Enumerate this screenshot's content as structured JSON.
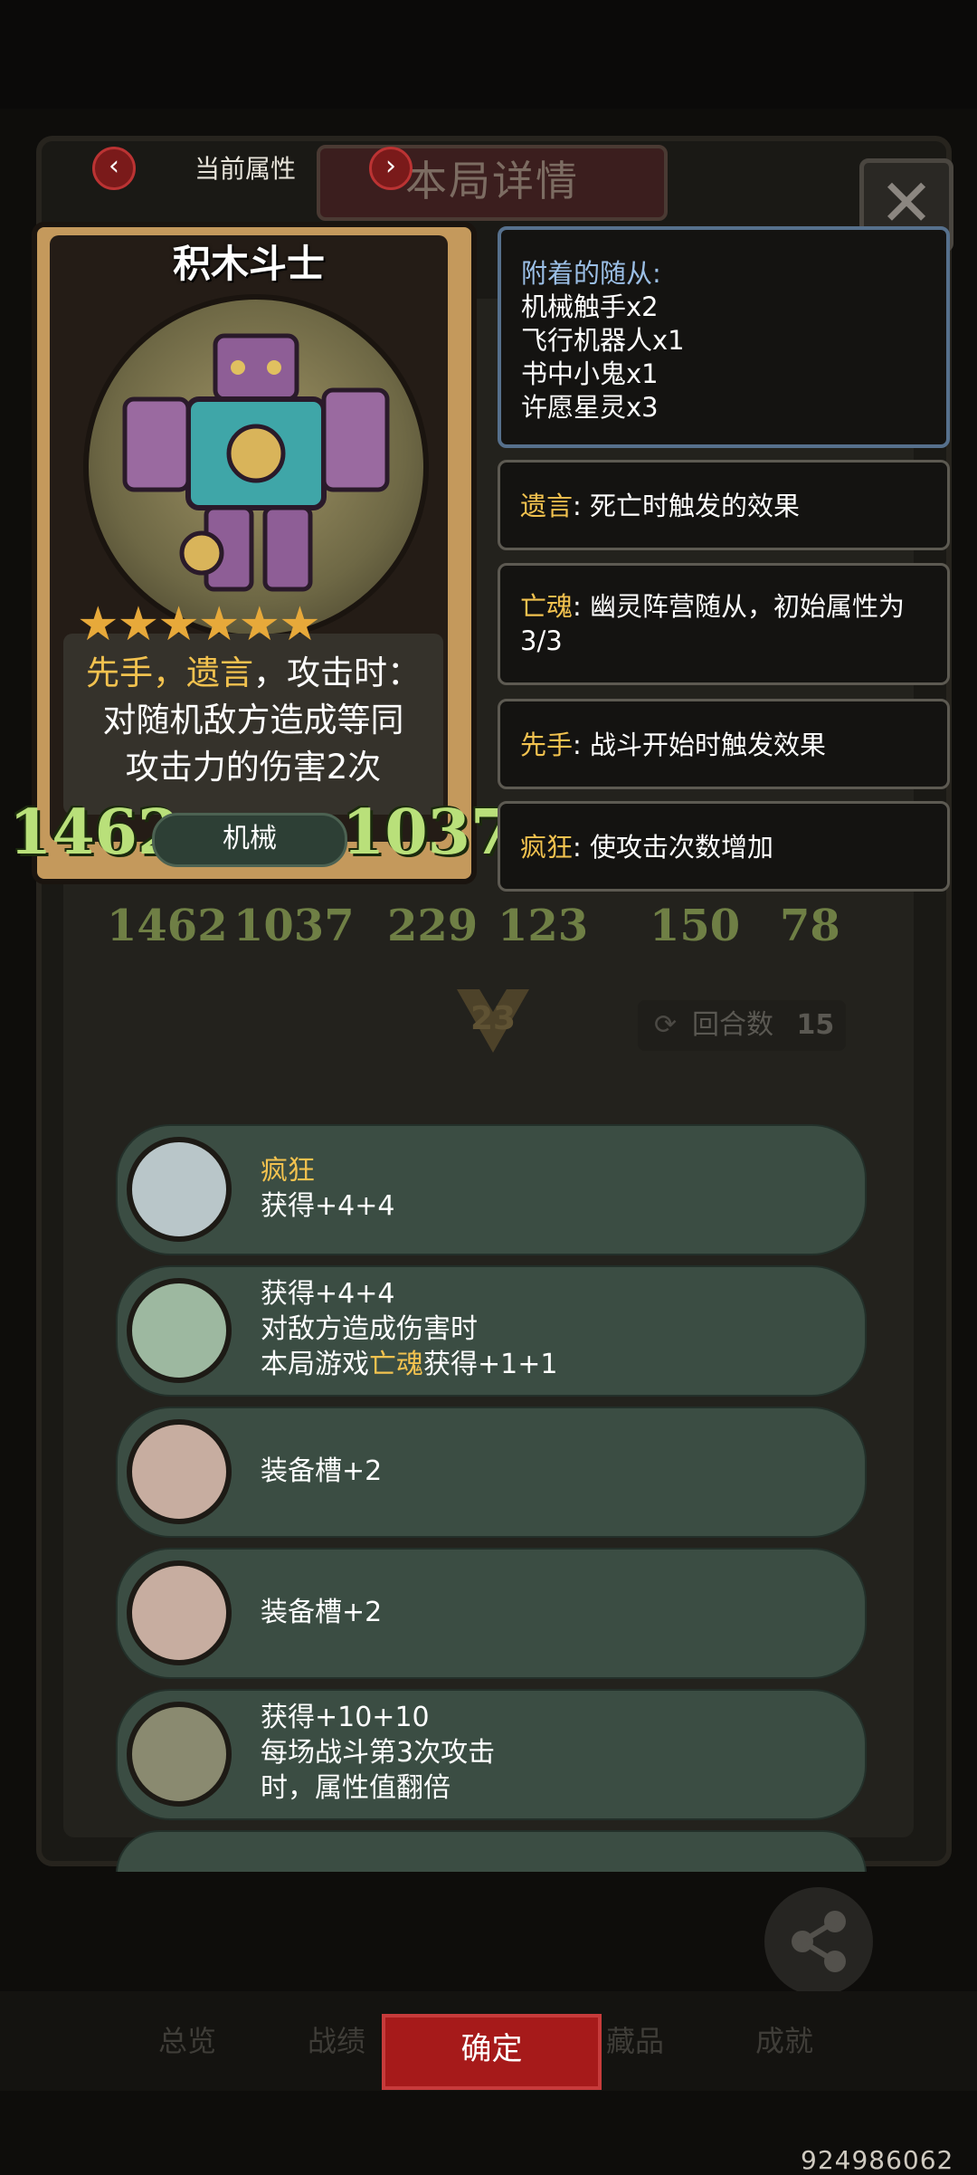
{
  "header": {
    "prev_arrow": "‹",
    "next_arrow": "›",
    "current_attr_label": "当前属性",
    "tab_title": "本局详情",
    "close": "✕"
  },
  "card": {
    "name": "积木斗士",
    "stars": "★★★★★★",
    "star_count": 6,
    "desc_line1_gold": "先手，遗言",
    "desc_line1_rest": "，攻击时：",
    "desc_line2": "对随机敌方造成等同",
    "desc_line3": "攻击力的伤害2次",
    "attack": "1462",
    "health": "1037",
    "type": "机械"
  },
  "info_boxes": {
    "attached_title": "附着的随从:",
    "attached": [
      "机械触手x2",
      "飞行机器人x1",
      "书中小鬼x1",
      "许愿星灵x3"
    ],
    "keywords": [
      {
        "key": "遗言",
        "text": ": 死亡时触发的效果"
      },
      {
        "key": "亡魂",
        "text": ": 幽灵阵营随从，初始属性为"
      },
      {
        "key": "先手",
        "text": ": 战斗开始时触发效果"
      },
      {
        "key": "疯狂",
        "text": ": 使攻击次数增加"
      }
    ],
    "keyword2_line2": "3/3"
  },
  "board": {
    "stats": [
      "1462",
      "1037",
      "229",
      "123",
      "150",
      "78"
    ],
    "chevron_num": "23",
    "round_label": "回合数",
    "round_value": "15"
  },
  "events": [
    {
      "title": "疯狂",
      "line1": "获得+4+4",
      "icon": "rune-stone-icon"
    },
    {
      "line1": "获得+4+4",
      "line2": "对敌方造成伤害时",
      "line3_pre": "本局游戏",
      "line3_gold": "亡魂",
      "line3_post": "获得+1+1",
      "icon": "green-blades-icon"
    },
    {
      "line1": "装备槽+2",
      "icon": "pig-armor-icon"
    },
    {
      "line1": "装备槽+2",
      "icon": "pig-armor-icon"
    },
    {
      "line1": "获得+10+10",
      "line2": "每场战斗第3次攻击",
      "line3": "时，属性值翻倍",
      "icon": "shadow-figure-icon"
    }
  ],
  "bottom": {
    "tabs": [
      "总览",
      "战绩",
      "藏品",
      "成就"
    ],
    "confirm": "确定",
    "share": "分享",
    "id": "924986062"
  },
  "colors": {
    "accent_red": "#a61a1a",
    "gold": "#f2c24f",
    "stat_green": "#b9e07a",
    "panel_teal": "#3b4d43"
  }
}
